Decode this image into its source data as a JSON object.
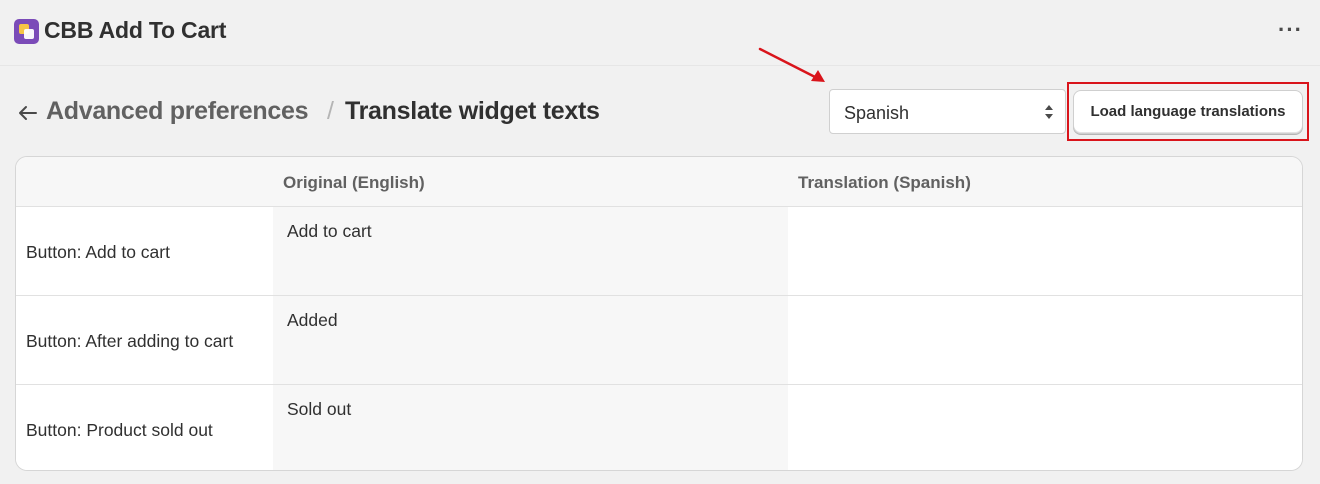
{
  "app": {
    "title": "CBB Add To Cart",
    "more_label": "···"
  },
  "breadcrumb": {
    "parent": "Advanced preferences",
    "separator": "/",
    "current": "Translate widget texts"
  },
  "language_select": {
    "selected": "Spanish"
  },
  "load_button": {
    "label": "Load language translations"
  },
  "colors": {
    "highlight": "#d9141b",
    "arrow": "#d9141b",
    "app_logo": "#7b4bb8"
  },
  "table": {
    "headers": [
      "",
      "Original (English)",
      "Translation (Spanish)"
    ],
    "rows": [
      {
        "label": "Button: Add to cart",
        "original": "Add to cart",
        "translation": ""
      },
      {
        "label": "Button: After adding to cart",
        "original": "Added",
        "translation": ""
      },
      {
        "label": "Button: Product sold out",
        "original": "Sold out",
        "translation": ""
      }
    ]
  }
}
